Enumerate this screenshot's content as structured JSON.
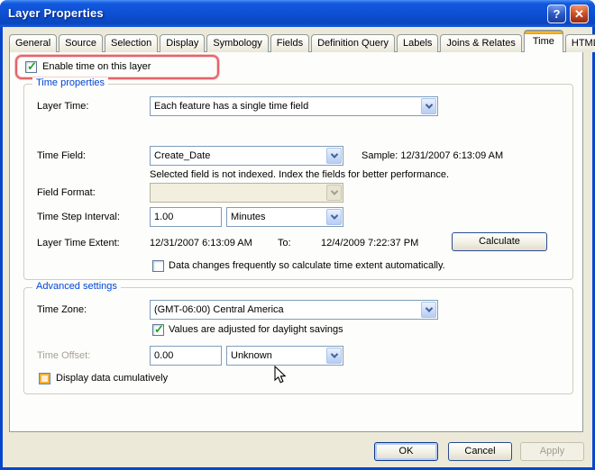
{
  "window": {
    "title": "Layer Properties",
    "help_glyph": "?",
    "close_glyph": "✕"
  },
  "tabs": [
    {
      "label": "General",
      "active": false
    },
    {
      "label": "Source",
      "active": false
    },
    {
      "label": "Selection",
      "active": false
    },
    {
      "label": "Display",
      "active": false
    },
    {
      "label": "Symbology",
      "active": false
    },
    {
      "label": "Fields",
      "active": false
    },
    {
      "label": "Definition Query",
      "active": false
    },
    {
      "label": "Labels",
      "active": false
    },
    {
      "label": "Joins & Relates",
      "active": false
    },
    {
      "label": "Time",
      "active": true
    },
    {
      "label": "HTML Popup",
      "active": false
    }
  ],
  "enable_time": {
    "label": "Enable time on this layer",
    "checked": true
  },
  "time_properties": {
    "title": "Time properties",
    "layer_time": {
      "label": "Layer Time:",
      "value": "Each feature has a single time field"
    },
    "time_field": {
      "label": "Time Field:",
      "value": "Create_Date",
      "sample": "Sample: 12/31/2007 6:13:09 AM",
      "note": "Selected field is not indexed. Index the fields for better performance."
    },
    "field_format": {
      "label": "Field Format:",
      "value": "",
      "disabled": true
    },
    "time_step": {
      "label": "Time Step Interval:",
      "value": "1.00",
      "unit": "Minutes"
    },
    "extent": {
      "label": "Layer Time Extent:",
      "start": "12/31/2007 6:13:09 AM",
      "to_label": "To:",
      "end": "12/4/2009 7:22:37 PM",
      "calculate_label": "Calculate"
    },
    "auto_calc": {
      "label": "Data changes frequently so calculate time extent automatically.",
      "checked": false
    }
  },
  "advanced_settings": {
    "title": "Advanced settings",
    "time_zone": {
      "label": "Time Zone:",
      "value": "(GMT-06:00) Central America"
    },
    "daylight": {
      "label": "Values are adjusted for daylight savings",
      "checked": true
    },
    "time_offset": {
      "label": "Time Offset:",
      "value": "0.00",
      "unit": "Unknown",
      "label_disabled": true
    },
    "cumulative": {
      "label": "Display data cumulatively",
      "checked": false
    }
  },
  "footer": {
    "ok_label": "OK",
    "ok_focused": true,
    "cancel_label": "Cancel",
    "apply_label": "Apply",
    "apply_disabled": true
  },
  "colors": {
    "titlebar_blue": "#0D4FD2",
    "frame_blue": "#0846CE",
    "dialog_tan": "#ECE9D8",
    "active_tab_accent": "#E5940F",
    "highlight_red": "#E4636B",
    "group_label_blue": "#0046D5",
    "check_green": "#1FA120"
  }
}
